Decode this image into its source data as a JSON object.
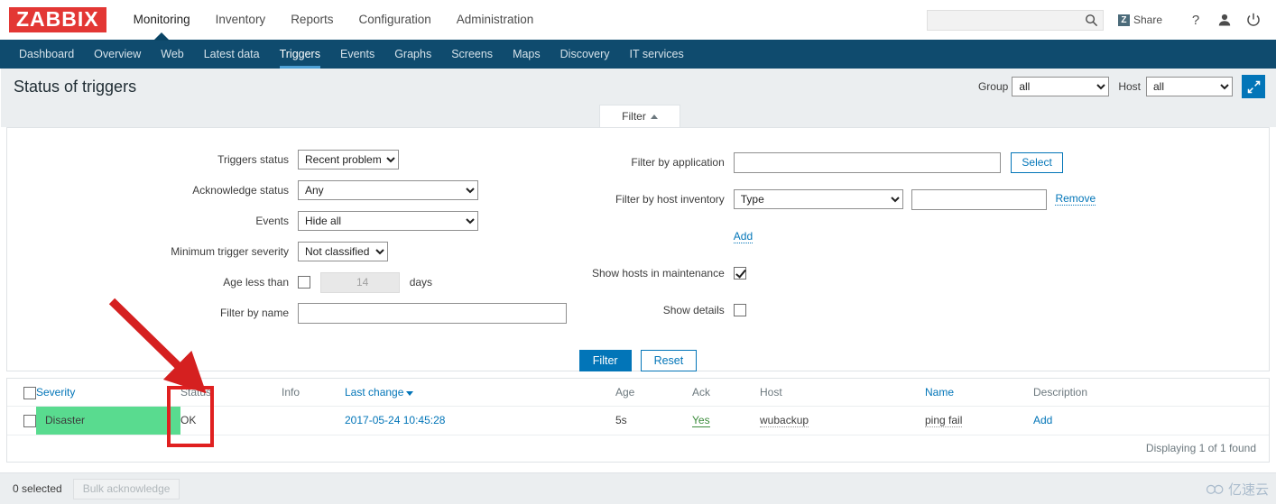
{
  "header": {
    "logo": "ZABBIX",
    "nav": [
      {
        "label": "Monitoring",
        "active": true
      },
      {
        "label": "Inventory",
        "active": false
      },
      {
        "label": "Reports",
        "active": false
      },
      {
        "label": "Configuration",
        "active": false
      },
      {
        "label": "Administration",
        "active": false
      }
    ],
    "search_placeholder": "",
    "search_value": "",
    "search_icon": "search-icon",
    "share_label": "Share",
    "share_badge": "Z",
    "help_icon": "question-mark-icon",
    "user_icon": "user-icon",
    "power_icon": "power-icon"
  },
  "subnav": [
    {
      "label": "Dashboard",
      "active": false
    },
    {
      "label": "Overview",
      "active": false
    },
    {
      "label": "Web",
      "active": false
    },
    {
      "label": "Latest data",
      "active": false
    },
    {
      "label": "Triggers",
      "active": true
    },
    {
      "label": "Events",
      "active": false
    },
    {
      "label": "Graphs",
      "active": false
    },
    {
      "label": "Screens",
      "active": false
    },
    {
      "label": "Maps",
      "active": false
    },
    {
      "label": "Discovery",
      "active": false
    },
    {
      "label": "IT services",
      "active": false
    }
  ],
  "page": {
    "title": "Status of triggers",
    "group_label": "Group",
    "group_value": "all",
    "host_label": "Host",
    "host_value": "all",
    "fullscreen_icon": "fullscreen-icon"
  },
  "filter": {
    "tab_label": "Filter",
    "tab_caret": "caret-up-icon",
    "left": {
      "triggers_status_label": "Triggers status",
      "triggers_status_value": "Recent problem",
      "acknowledge_status_label": "Acknowledge status",
      "acknowledge_status_value": "Any",
      "events_label": "Events",
      "events_value": "Hide all",
      "min_severity_label": "Minimum trigger severity",
      "min_severity_value": "Not classified",
      "age_label": "Age less than",
      "age_value": "14",
      "age_unit": "days",
      "age_checked": false,
      "name_label": "Filter by name",
      "name_value": ""
    },
    "right": {
      "application_label": "Filter by application",
      "application_value": "",
      "application_select_btn": "Select",
      "inventory_label": "Filter by host inventory",
      "inventory_type_value": "Type",
      "inventory_text_value": "",
      "inventory_remove": "Remove",
      "inventory_add": "Add",
      "maintenance_label": "Show hosts in maintenance",
      "maintenance_checked": true,
      "details_label": "Show details",
      "details_checked": false
    },
    "apply_btn": "Filter",
    "reset_btn": "Reset"
  },
  "table": {
    "columns": [
      {
        "key": "severity",
        "label": "Severity",
        "style": "link"
      },
      {
        "key": "status",
        "label": "Status",
        "style": "plain"
      },
      {
        "key": "info",
        "label": "Info",
        "style": "plain"
      },
      {
        "key": "last_change",
        "label": "Last change",
        "style": "link",
        "sorted": true,
        "sort_dir": "desc"
      },
      {
        "key": "age",
        "label": "Age",
        "style": "plain"
      },
      {
        "key": "ack",
        "label": "Ack",
        "style": "plain"
      },
      {
        "key": "host",
        "label": "Host",
        "style": "plain"
      },
      {
        "key": "name",
        "label": "Name",
        "style": "link"
      },
      {
        "key": "description",
        "label": "Description",
        "style": "plain"
      }
    ],
    "rows": [
      {
        "severity": "Disaster",
        "status": "OK",
        "info": "",
        "last_change": "2017-05-24 10:45:28",
        "age": "5s",
        "ack": "Yes",
        "host": "wubackup",
        "name": "ping fail",
        "description": "Add"
      }
    ],
    "footer": "Displaying 1 of 1 found"
  },
  "bottom": {
    "selected_text": "0 selected",
    "bulk_ack_btn": "Bulk acknowledge",
    "watermark": "亿速云",
    "watermark_icon": "cloud-icon"
  },
  "colors": {
    "brand_red": "#e33734",
    "nav_dark": "#0f4b6e",
    "accent_blue": "#0275b8",
    "severity_ok_green": "#59db8f",
    "annotation_red": "#e02020"
  }
}
